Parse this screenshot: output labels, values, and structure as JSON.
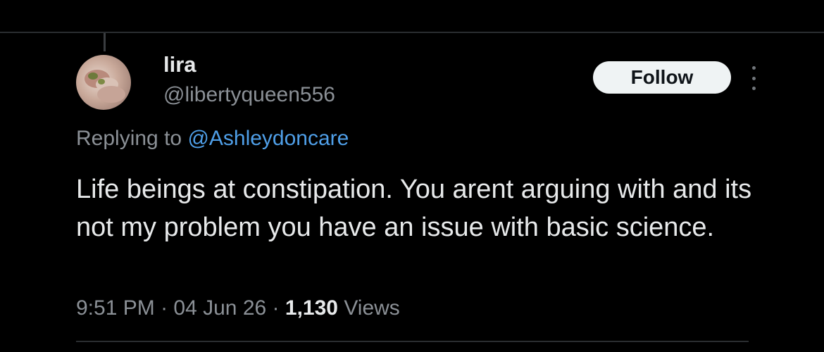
{
  "tweet": {
    "author": {
      "display_name": "lira",
      "handle": "@libertyqueen556",
      "avatar_icon": "user-avatar-photo"
    },
    "follow_label": "Follow",
    "more_icon": "more-vertical-icon",
    "replying_prefix": "Replying to",
    "replying_to": "@Ashleydoncare",
    "text": "Life beings at constipation. You arent arguing with and its not my problem you have an issue with basic science.",
    "time": "9:51 PM",
    "date": "04 Jun 26",
    "separator": "·",
    "views_count": "1,130",
    "views_label": "Views"
  },
  "colors": {
    "background": "#000000",
    "text_primary": "#e7e9ea",
    "text_secondary": "#8b9096",
    "mention": "#4f9fe8",
    "follow_bg": "#eff3f4"
  }
}
